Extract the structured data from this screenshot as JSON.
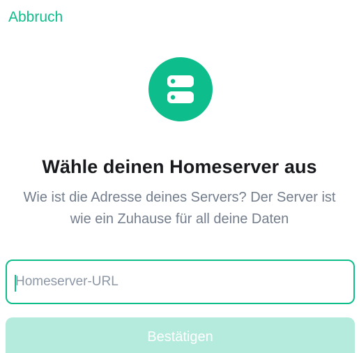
{
  "header": {
    "cancel_label": "Abbruch"
  },
  "icon": {
    "name": "server-icon",
    "background_color": "#0dbd8b"
  },
  "content": {
    "title": "Wähle deinen Homeserver aus",
    "subtitle_line1": "Wie ist die Adresse deines Servers? Der Server ist",
    "subtitle_line2": "wie ein Zuhause für all deine Daten"
  },
  "form": {
    "url_value": "",
    "url_placeholder": "Homeserver-URL",
    "confirm_label": "Bestätigen",
    "confirm_enabled": false
  },
  "colors": {
    "accent": "#0dbd8b",
    "button_disabled": "#b4ebdc",
    "title_text": "#17191c",
    "secondary_text": "#737d8c"
  }
}
